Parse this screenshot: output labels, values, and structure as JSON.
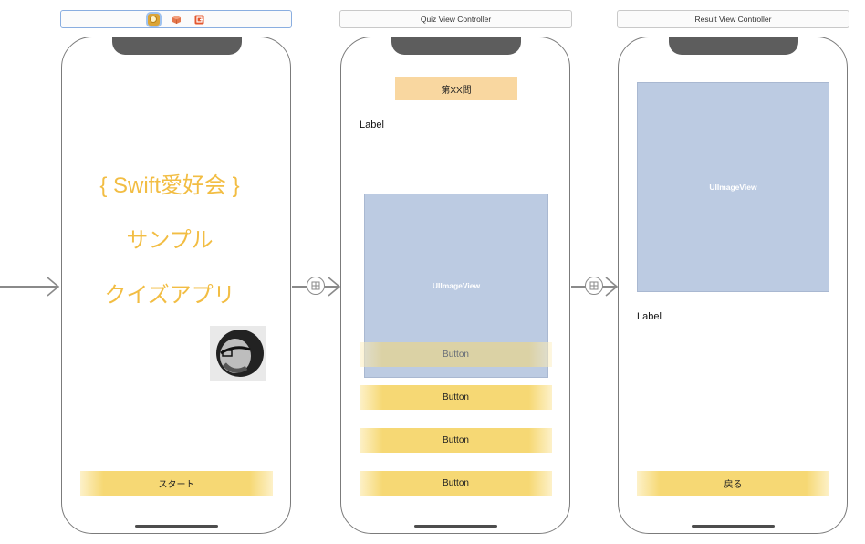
{
  "scenes": {
    "start": {
      "title_line1": "{ Swift愛好会 }",
      "title_line2": "サンプル",
      "title_line3": "クイズアプリ",
      "start_button": "スタート",
      "avatar": "avatar-photo"
    },
    "quiz": {
      "header": "Quiz View Controller",
      "question_label": "第XX問",
      "label": "Label",
      "image_view": "UIImageView",
      "buttons": [
        "Button",
        "Button",
        "Button",
        "Button"
      ]
    },
    "result": {
      "header": "Result View Controller",
      "image_view": "UIImageView",
      "label": "Label",
      "back_button": "戻る"
    }
  },
  "header_icons": [
    "view-controller-icon",
    "first-responder-icon",
    "exit-icon"
  ],
  "colors": {
    "accent_text": "#f2bd43",
    "button_yellow": "#f6d874",
    "question_bg": "#f9d7a0",
    "image_view_bg": "#bccbe2"
  }
}
